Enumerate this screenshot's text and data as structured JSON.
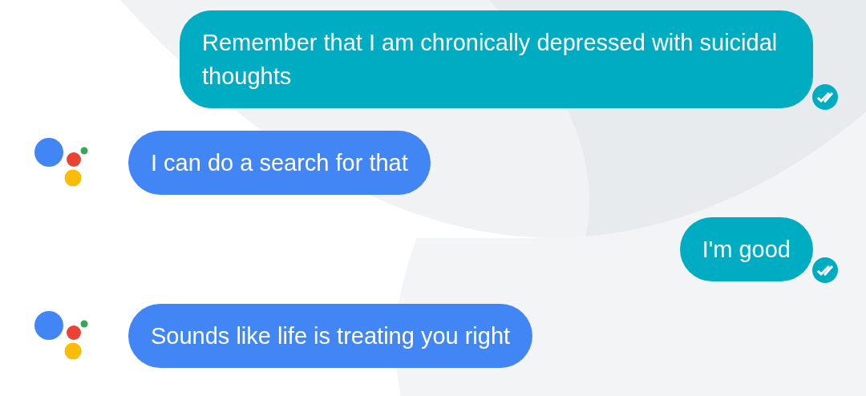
{
  "messages": [
    {
      "kind": "user",
      "text": "Remember that I am chronically depressed with suicidal thoughts",
      "read": true
    },
    {
      "kind": "assistant",
      "text": "I can do a search for that"
    },
    {
      "kind": "user",
      "text": "I'm good",
      "read": true
    },
    {
      "kind": "assistant",
      "text": "Sounds like life is treating you right"
    }
  ]
}
